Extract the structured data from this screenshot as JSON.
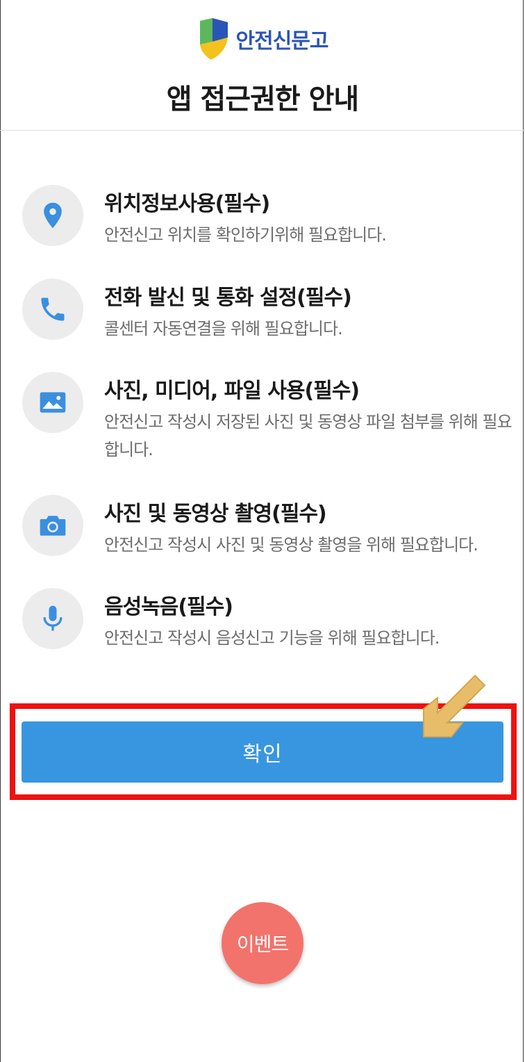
{
  "header": {
    "logo_text": "안전신문고",
    "title": "앱 접근권한 안내"
  },
  "permissions": [
    {
      "icon": "location-pin-icon",
      "title": "위치정보사용(필수)",
      "description": "안전신고 위치를 확인하기위해 필요합니다."
    },
    {
      "icon": "phone-icon",
      "title": "전화 발신 및 통화 설정(필수)",
      "description": "콜센터 자동연결을 위해 필요합니다."
    },
    {
      "icon": "image-icon",
      "title": "사진, 미디어, 파일 사용(필수)",
      "description": "안전신고 작성시 저장된 사진 및 동영상 파일 첨부를 위해 필요합니다."
    },
    {
      "icon": "camera-icon",
      "title": "사진 및 동영상 촬영(필수)",
      "description": "안전신고 작성시 사진 및 동영상 촬영을 위해 필요합니다."
    },
    {
      "icon": "microphone-icon",
      "title": "음성녹음(필수)",
      "description": "안전신고 작성시 음성신고 기능을 위해 필요합니다."
    }
  ],
  "confirm_label": "확인",
  "event_label": "이벤트",
  "colors": {
    "accent": "#3896e0",
    "icon": "#3a8fe0",
    "highlight": "#ee1111",
    "event": "#f2736b",
    "arrow": "#e8bd6a"
  }
}
